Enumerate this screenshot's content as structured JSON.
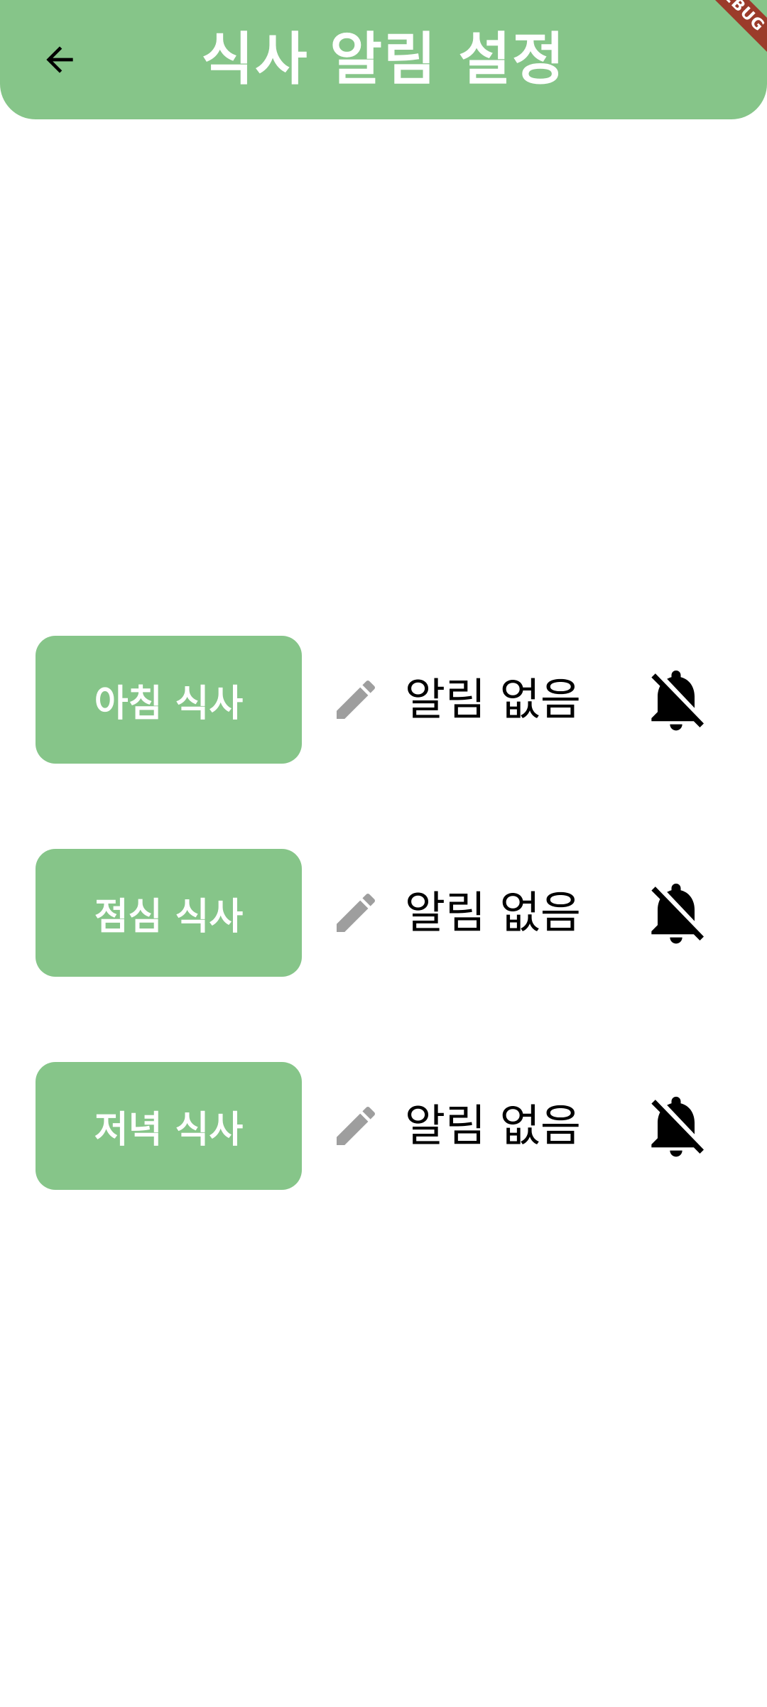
{
  "app_bar": {
    "title": "식사 알림 설정",
    "back_icon": "arrow-back-icon",
    "background_color": "#86c589",
    "debug_banner": "DEBUG"
  },
  "meals": [
    {
      "label": "아침 식사",
      "edit_icon": "pencil-icon",
      "alarm_status": "알림 없음",
      "alarm_icon": "notifications-off-icon"
    },
    {
      "label": "점심 식사",
      "edit_icon": "pencil-icon",
      "alarm_status": "알림 없음",
      "alarm_icon": "notifications-off-icon"
    },
    {
      "label": "저녁 식사",
      "edit_icon": "pencil-icon",
      "alarm_status": "알림 없음",
      "alarm_icon": "notifications-off-icon"
    }
  ],
  "colors": {
    "accent": "#86c589",
    "edit_icon": "#9e9e9e",
    "text": "#000000"
  }
}
